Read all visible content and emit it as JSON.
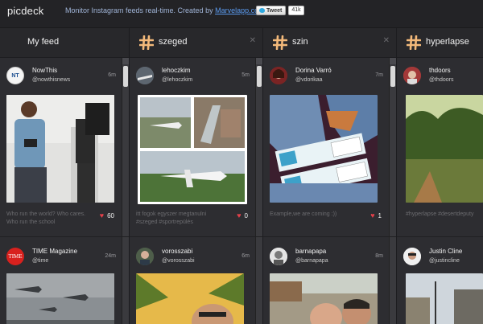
{
  "app": {
    "logo": "picdeck",
    "tagline_text": "Monitor Instagram feeds real-time. Created by ",
    "tagline_link": "Marvelapp.com",
    "tweet_label": "Tweet",
    "tweet_count": "41k"
  },
  "columns": [
    {
      "title": "My feed",
      "cards": [
        {
          "name": "NowThis",
          "handle": "@nowthisnews",
          "time": "6m",
          "caption": "Who run the world? Who cares. Who run the school",
          "likes": "60"
        },
        {
          "name": "TIME Magazine",
          "handle": "@time",
          "time": "24m"
        }
      ]
    },
    {
      "title": "szeged",
      "cards": [
        {
          "name": "lehoczkim",
          "handle": "@lehoczkim",
          "time": "5m",
          "caption": "itt fogok egyszer megtanulni #szeged #sportrepülés",
          "likes": "0"
        },
        {
          "name": "vorosszabi",
          "handle": "@vorosszabi",
          "time": "6m"
        }
      ]
    },
    {
      "title": "szin",
      "cards": [
        {
          "name": "Dorina Varró",
          "handle": "@vdorikaa",
          "time": "7m",
          "caption": "Example,we are coming :))",
          "likes": "1"
        },
        {
          "name": "barnapapa",
          "handle": "@barnapapa",
          "time": "8m"
        }
      ]
    },
    {
      "title": "hyperlapse",
      "cards": [
        {
          "name": "thdoors",
          "handle": "@thdoors",
          "time": "",
          "caption": "#hyperlapse #desertdeputy",
          "likes": ""
        },
        {
          "name": "Justin Cline",
          "handle": "@justincline",
          "time": ""
        }
      ]
    }
  ],
  "colors": {
    "heart": "#e4404a",
    "hashtag": "#f3b97a",
    "link": "#5b9bf0"
  }
}
